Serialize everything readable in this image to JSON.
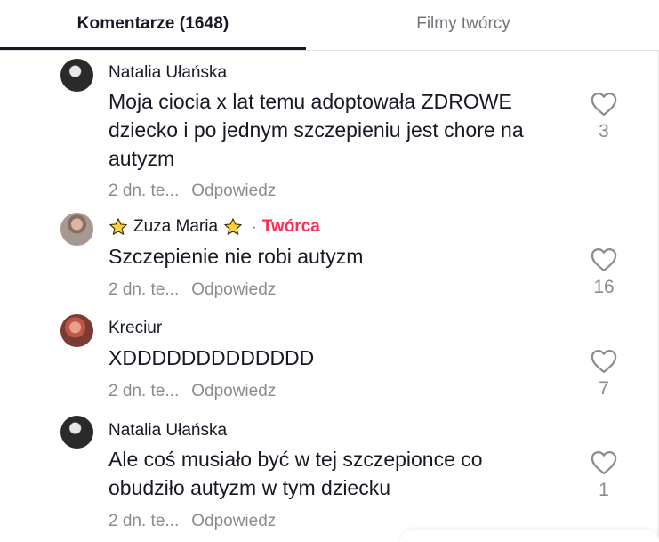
{
  "tabs": {
    "comments_label": "Komentarze (1648)",
    "videos_label": "Filmy twórcy"
  },
  "comments": [
    {
      "username": "Natalia Ułańska",
      "text_lines": [
        "Moja ciocia x lat temu adoptowała ZDROWE",
        "dziecko i po jednym szczepieniu jest chore na",
        "autyzm"
      ],
      "time": "2 dn. te...",
      "reply_label": "Odpowiedz",
      "likes": "3"
    },
    {
      "username": "Zuza Maria",
      "creator_separator": "·",
      "creator_label": "Twórca",
      "text_lines": [
        "Szczepienie nie robi autyzm"
      ],
      "time": "2 dn. te...",
      "reply_label": "Odpowiedz",
      "likes": "16"
    },
    {
      "username": "Kreciur",
      "text_lines": [
        "XDDDDDDDDDDDDD"
      ],
      "time": "2 dn. te...",
      "reply_label": "Odpowiedz",
      "likes": "7"
    },
    {
      "username": "Natalia Ułańska",
      "text_lines": [
        "Ale coś musiało być w tej szczepionce co",
        "obudziło autyzm w tym dziecku"
      ],
      "time": "2 dn. te...",
      "reply_label": "Odpowiedz",
      "likes": "1"
    }
  ],
  "icons": {
    "like": "heart-outline-icon",
    "star": "star-icon"
  },
  "colors": {
    "creator_badge": "#fe2c55",
    "star_fill": "#ffd23c",
    "secondary_text": "#8a8b91"
  }
}
